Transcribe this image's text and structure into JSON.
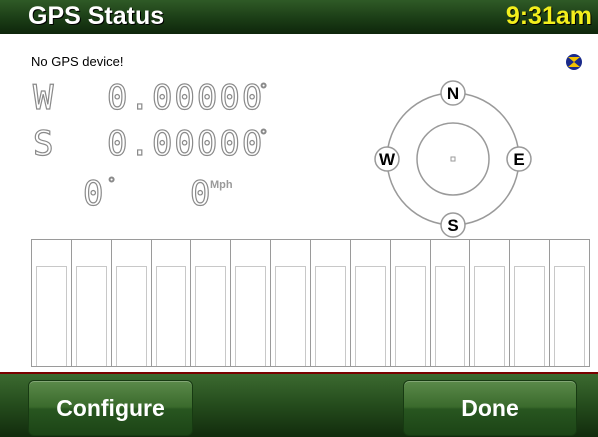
{
  "titlebar": {
    "title": "GPS Status",
    "time": "9:31am"
  },
  "status": {
    "message": "No GPS device!",
    "icon": "satellite-icon"
  },
  "position": {
    "lat_dir": "W",
    "lat_value": "0.00000",
    "lon_dir": "S",
    "lon_value": "0.00000",
    "degree_symbol": "°",
    "heading": "0",
    "speed": "0",
    "speed_unit": "Mph"
  },
  "compass": {
    "n": "N",
    "e": "E",
    "s": "S",
    "w": "W"
  },
  "signal_bars": {
    "count": 14
  },
  "buttons": {
    "configure": "Configure",
    "done": "Done"
  },
  "colors": {
    "title_bg": "#1b3d16",
    "time": "#f3ef1c",
    "button": "#3a6a2c",
    "segment_outline": "#8a8a8a"
  }
}
